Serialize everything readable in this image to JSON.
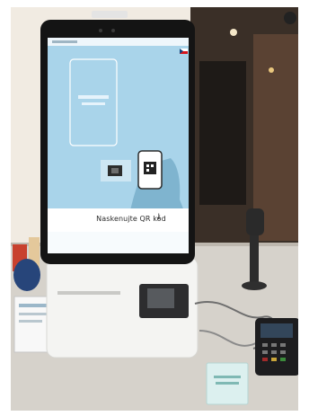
{
  "scene": {
    "kiosk_screen": {
      "instruction_text": "Naskenujte QR kód",
      "arrow_icon": "arrow-down-icon",
      "language_icon": "czech-flag-icon"
    },
    "colors": {
      "screen_background": "#a9d4ea",
      "kiosk_body": "#f4f4f2",
      "counter": "#d9d6d0",
      "wall": "#f1ebe2"
    }
  }
}
